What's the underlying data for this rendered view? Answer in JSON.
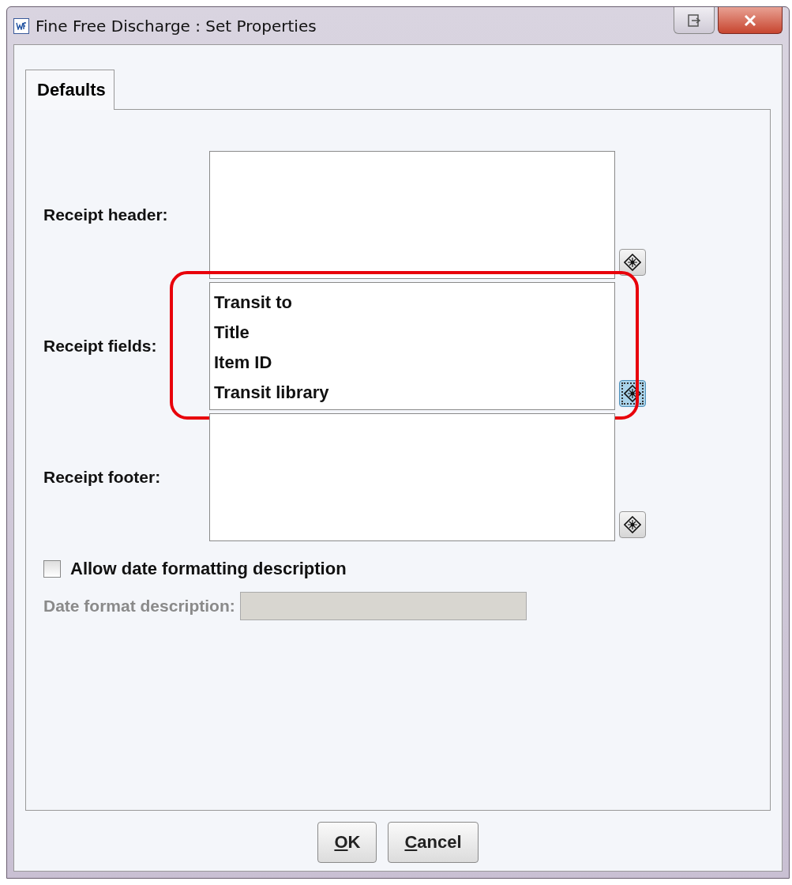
{
  "window": {
    "title": "Fine Free Discharge : Set Properties"
  },
  "tabs": [
    {
      "label": "Defaults",
      "selected": true
    }
  ],
  "sections": [
    {
      "label": "Receipt header:",
      "highlighted": false,
      "button_focused": false
    },
    {
      "label": "Receipt fields:",
      "lines": [
        "Transit to",
        "Title",
        "Item ID",
        "Transit library"
      ],
      "highlighted": true,
      "button_focused": true
    },
    {
      "label": "Receipt footer:",
      "highlighted": false,
      "button_focused": false
    }
  ],
  "allow_date": {
    "label": "Allow date formatting description",
    "checked": false
  },
  "date_format": {
    "label": "Date format description:",
    "disabled": true
  },
  "buttons": [
    {
      "label": "OK",
      "underline_first": true
    },
    {
      "label": "Cancel",
      "underline_first": true
    }
  ]
}
